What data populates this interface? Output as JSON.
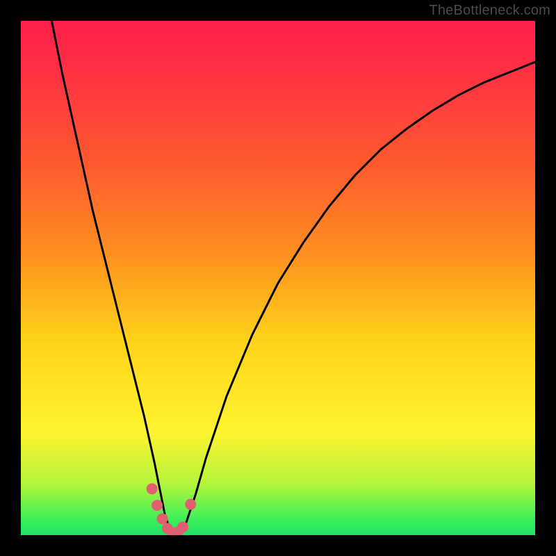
{
  "watermark": "TheBottleneck.com",
  "chart_data": {
    "type": "line",
    "title": "",
    "xlabel": "",
    "ylabel": "",
    "xlim": [
      0,
      100
    ],
    "ylim": [
      0,
      100
    ],
    "series": [
      {
        "name": "bottleneck-curve",
        "x": [
          6,
          8,
          10,
          12,
          14,
          16,
          18,
          20,
          22,
          24,
          26,
          27,
          28,
          29,
          30,
          31,
          32,
          34,
          36,
          40,
          45,
          50,
          55,
          60,
          65,
          70,
          75,
          80,
          85,
          90,
          95,
          100
        ],
        "values": [
          100,
          90,
          81,
          72,
          63,
          55,
          47,
          39,
          31,
          23,
          14,
          9,
          4,
          1,
          0,
          0.5,
          2,
          8,
          15,
          27,
          39,
          49,
          57,
          64,
          70,
          75,
          79,
          82.5,
          85.5,
          88,
          90,
          92
        ]
      }
    ],
    "markers": {
      "name": "trough-markers",
      "color": "#e06070",
      "x": [
        25.5,
        26.5,
        27.5,
        28.5,
        29.5,
        30.5,
        31.5,
        33.0
      ],
      "values": [
        9.0,
        5.8,
        3.2,
        1.3,
        0.4,
        0.6,
        1.6,
        6.0
      ]
    },
    "gradient_stops": [
      {
        "pos": 0.0,
        "color": "#ff1f4b"
      },
      {
        "pos": 0.28,
        "color": "#ff5a2f"
      },
      {
        "pos": 0.62,
        "color": "#ffd21a"
      },
      {
        "pos": 0.9,
        "color": "#b3f53a"
      },
      {
        "pos": 1.0,
        "color": "#22e06a"
      }
    ]
  }
}
